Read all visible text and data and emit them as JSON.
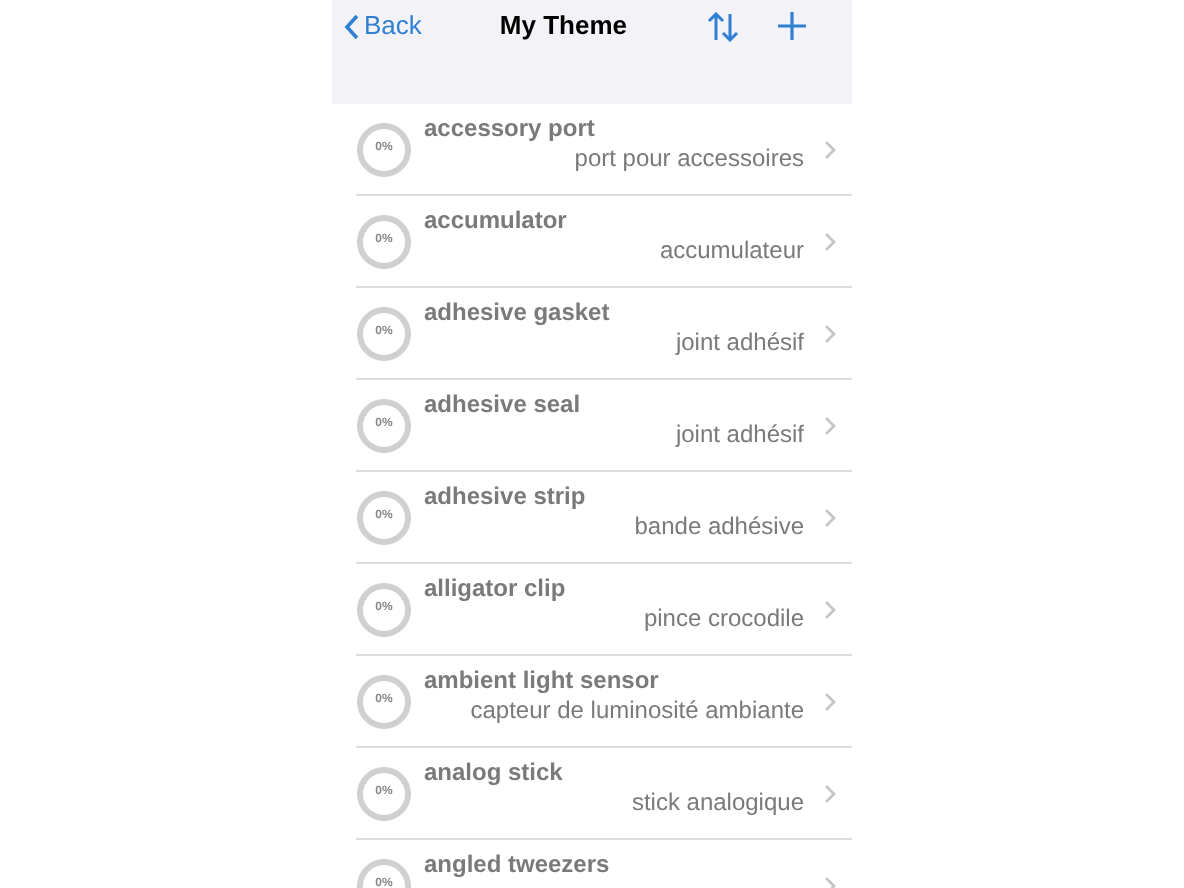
{
  "nav": {
    "back": "Back",
    "title": "My Theme"
  },
  "items": [
    {
      "term": "accessory port",
      "translation": "port pour accessoires",
      "progress": "0%",
      "level": 0
    },
    {
      "term": "accumulator",
      "translation": "accumulateur",
      "progress": "0%",
      "level": 0
    },
    {
      "term": "adhesive gasket",
      "translation": "joint adhésif",
      "progress": "0%",
      "level": 0
    },
    {
      "term": "adhesive seal",
      "translation": "joint adhésif",
      "progress": "0%",
      "level": 0
    },
    {
      "term": "adhesive strip",
      "translation": "bande adhésive",
      "progress": "0%",
      "level": 0
    },
    {
      "term": "alligator clip",
      "translation": "pince crocodile",
      "progress": "0%",
      "level": 0
    },
    {
      "term": "ambient light sensor",
      "translation": "capteur de luminosité ambiante",
      "progress": "0%",
      "level": 0
    },
    {
      "term": "analog stick",
      "translation": "stick analogique",
      "progress": "0%",
      "level": 0
    },
    {
      "term": "angled tweezers",
      "progress": "0%",
      "level": 0
    }
  ]
}
